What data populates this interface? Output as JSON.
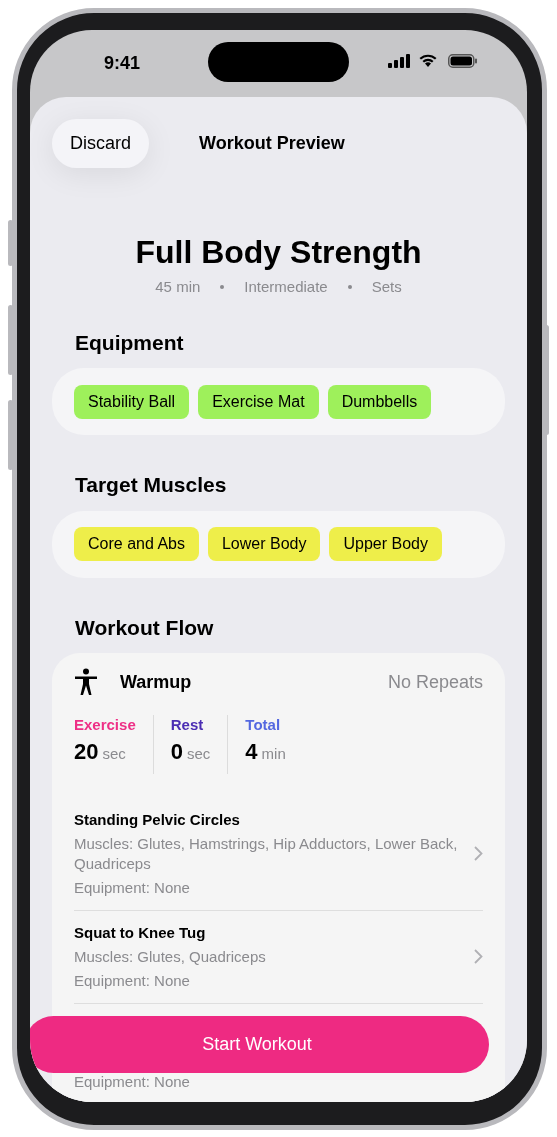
{
  "status_bar": {
    "time": "9:41"
  },
  "nav": {
    "discard": "Discard",
    "title": "Workout Preview"
  },
  "workout": {
    "title": "Full Body Strength",
    "meta": [
      "45 min",
      "Intermediate",
      "Sets"
    ]
  },
  "sections": [
    {
      "heading": "Equipment",
      "kind": "equipment",
      "tags": [
        "Stability Ball",
        "Exercise Mat",
        "Dumbbells"
      ]
    },
    {
      "heading": "Target Muscles",
      "kind": "muscles",
      "tags": [
        "Core and Abs",
        "Lower Body",
        "Upper Body"
      ]
    }
  ],
  "flow": {
    "heading": "Workout Flow",
    "block": {
      "name": "Warmup",
      "repeats": "No Repeats",
      "stats": [
        {
          "label": "Exercise",
          "value": "20",
          "unit": "sec",
          "color": "#ee2f86"
        },
        {
          "label": "Rest",
          "value": "0",
          "unit": "sec",
          "color": "#4b2db3"
        },
        {
          "label": "Total",
          "value": "4",
          "unit": "min",
          "color": "#5468e0"
        }
      ],
      "exercises": [
        {
          "name": "Standing Pelvic Circles",
          "muscles": "Muscles: Glutes, Hamstrings, Hip Adductors, Lower Back, Quadriceps",
          "equipment": "Equipment: None"
        },
        {
          "name": "Squat to Knee Tug",
          "muscles": "Muscles: Glutes, Quadriceps",
          "equipment": "Equipment: None"
        },
        {
          "equipment": "Equipment: None"
        }
      ]
    }
  },
  "start_button": "Start Workout"
}
